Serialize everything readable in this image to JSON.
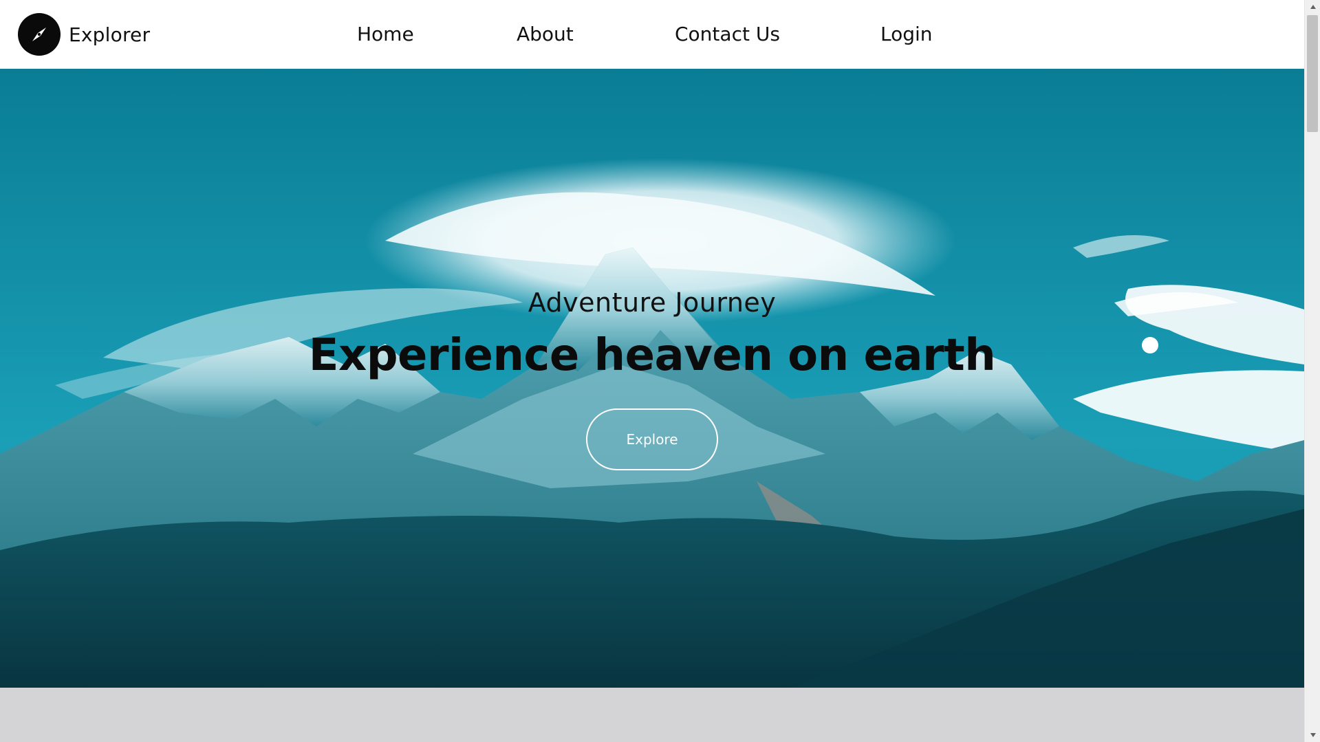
{
  "brand": {
    "name": "Explorer",
    "logo_icon": "compass-icon"
  },
  "nav": {
    "items": [
      {
        "label": "Home"
      },
      {
        "label": "About"
      },
      {
        "label": "Contact Us"
      },
      {
        "label": "Login"
      }
    ]
  },
  "hero": {
    "subtitle": "Adventure Journey",
    "title": "Experience heaven on earth",
    "button_label": "Explore",
    "background": "snow-capped mountain under a lenticular cloud, teal sky"
  },
  "colors": {
    "navbar_bg": "#ffffff",
    "sky_teal": "#1495ad",
    "below_section_bg": "#d4d4d6",
    "button_border": "#ffffff"
  }
}
